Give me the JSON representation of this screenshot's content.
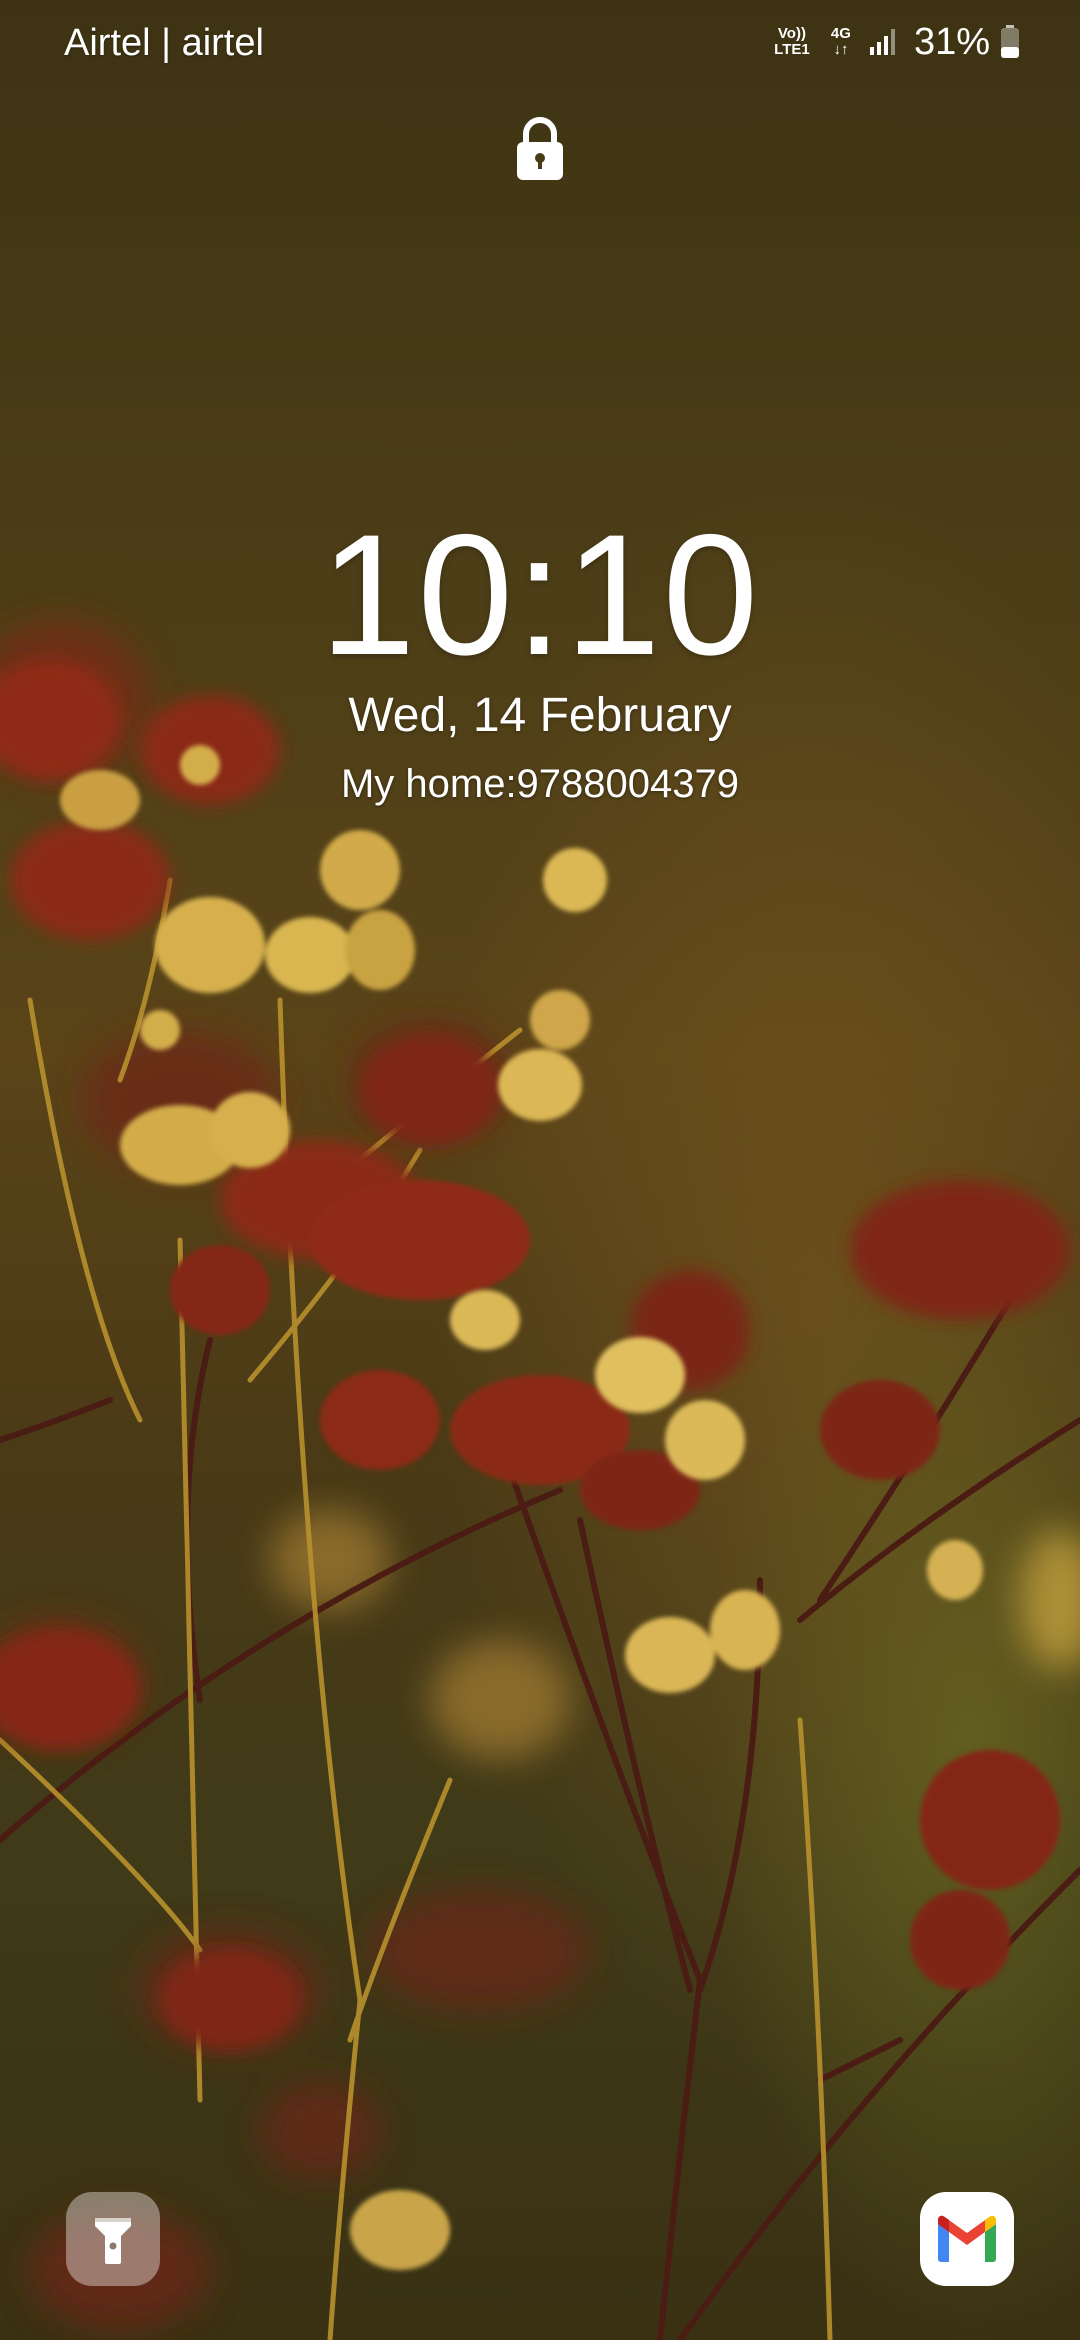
{
  "status_bar": {
    "carrier": "Airtel | airtel",
    "volte_top": "Vo))",
    "volte_bottom": "LTE1",
    "network_type": "4G",
    "battery_percent": "31%",
    "icons": [
      "volte-icon",
      "4g-data-icon",
      "signal-icon",
      "battery-icon"
    ]
  },
  "lock_screen": {
    "lock_icon": "padlock-icon",
    "time": "10:10",
    "date": "Wed, 14 February",
    "owner_info": "My home:9788004379"
  },
  "shortcuts": {
    "left": "flashlight-icon",
    "right": "gmail-icon"
  },
  "colors": {
    "text": "#ffffff",
    "wallpaper_base": "#4a3c17",
    "gmail_red": "#EA4335",
    "gmail_blue": "#4285F4",
    "gmail_green": "#34A853",
    "gmail_yellow": "#FBBC04"
  }
}
